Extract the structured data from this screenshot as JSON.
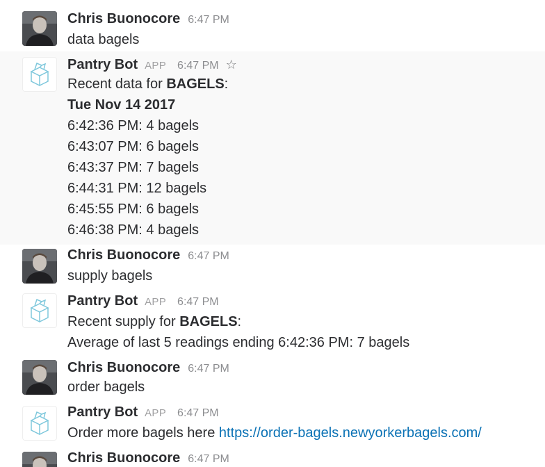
{
  "users": {
    "chris": "Chris Buonocore",
    "bot": "Pantry Bot",
    "app_badge": "APP"
  },
  "time": "6:47 PM",
  "messages": [
    {
      "text": "data bagels"
    },
    {
      "prefix": "Recent data for ",
      "item": "BAGELS",
      "suffix": ":",
      "date": "Tue Nov 14 2017",
      "readings": [
        "6:42:36 PM: 4 bagels",
        "6:43:07 PM: 6 bagels",
        "6:43:37 PM: 7 bagels",
        "6:44:31 PM: 12 bagels",
        "6:45:55 PM: 6 bagels",
        "6:46:38 PM: 4 bagels"
      ]
    },
    {
      "text": "supply bagels"
    },
    {
      "prefix": "Recent supply for ",
      "item": "BAGELS",
      "suffix": ":",
      "average": "Average of last 5 readings ending 6:42:36 PM: 7 bagels"
    },
    {
      "text": "order bagels"
    },
    {
      "prefix": "Order more bagels here ",
      "link": "https://order-bagels.newyorkerbagels.com/"
    }
  ]
}
